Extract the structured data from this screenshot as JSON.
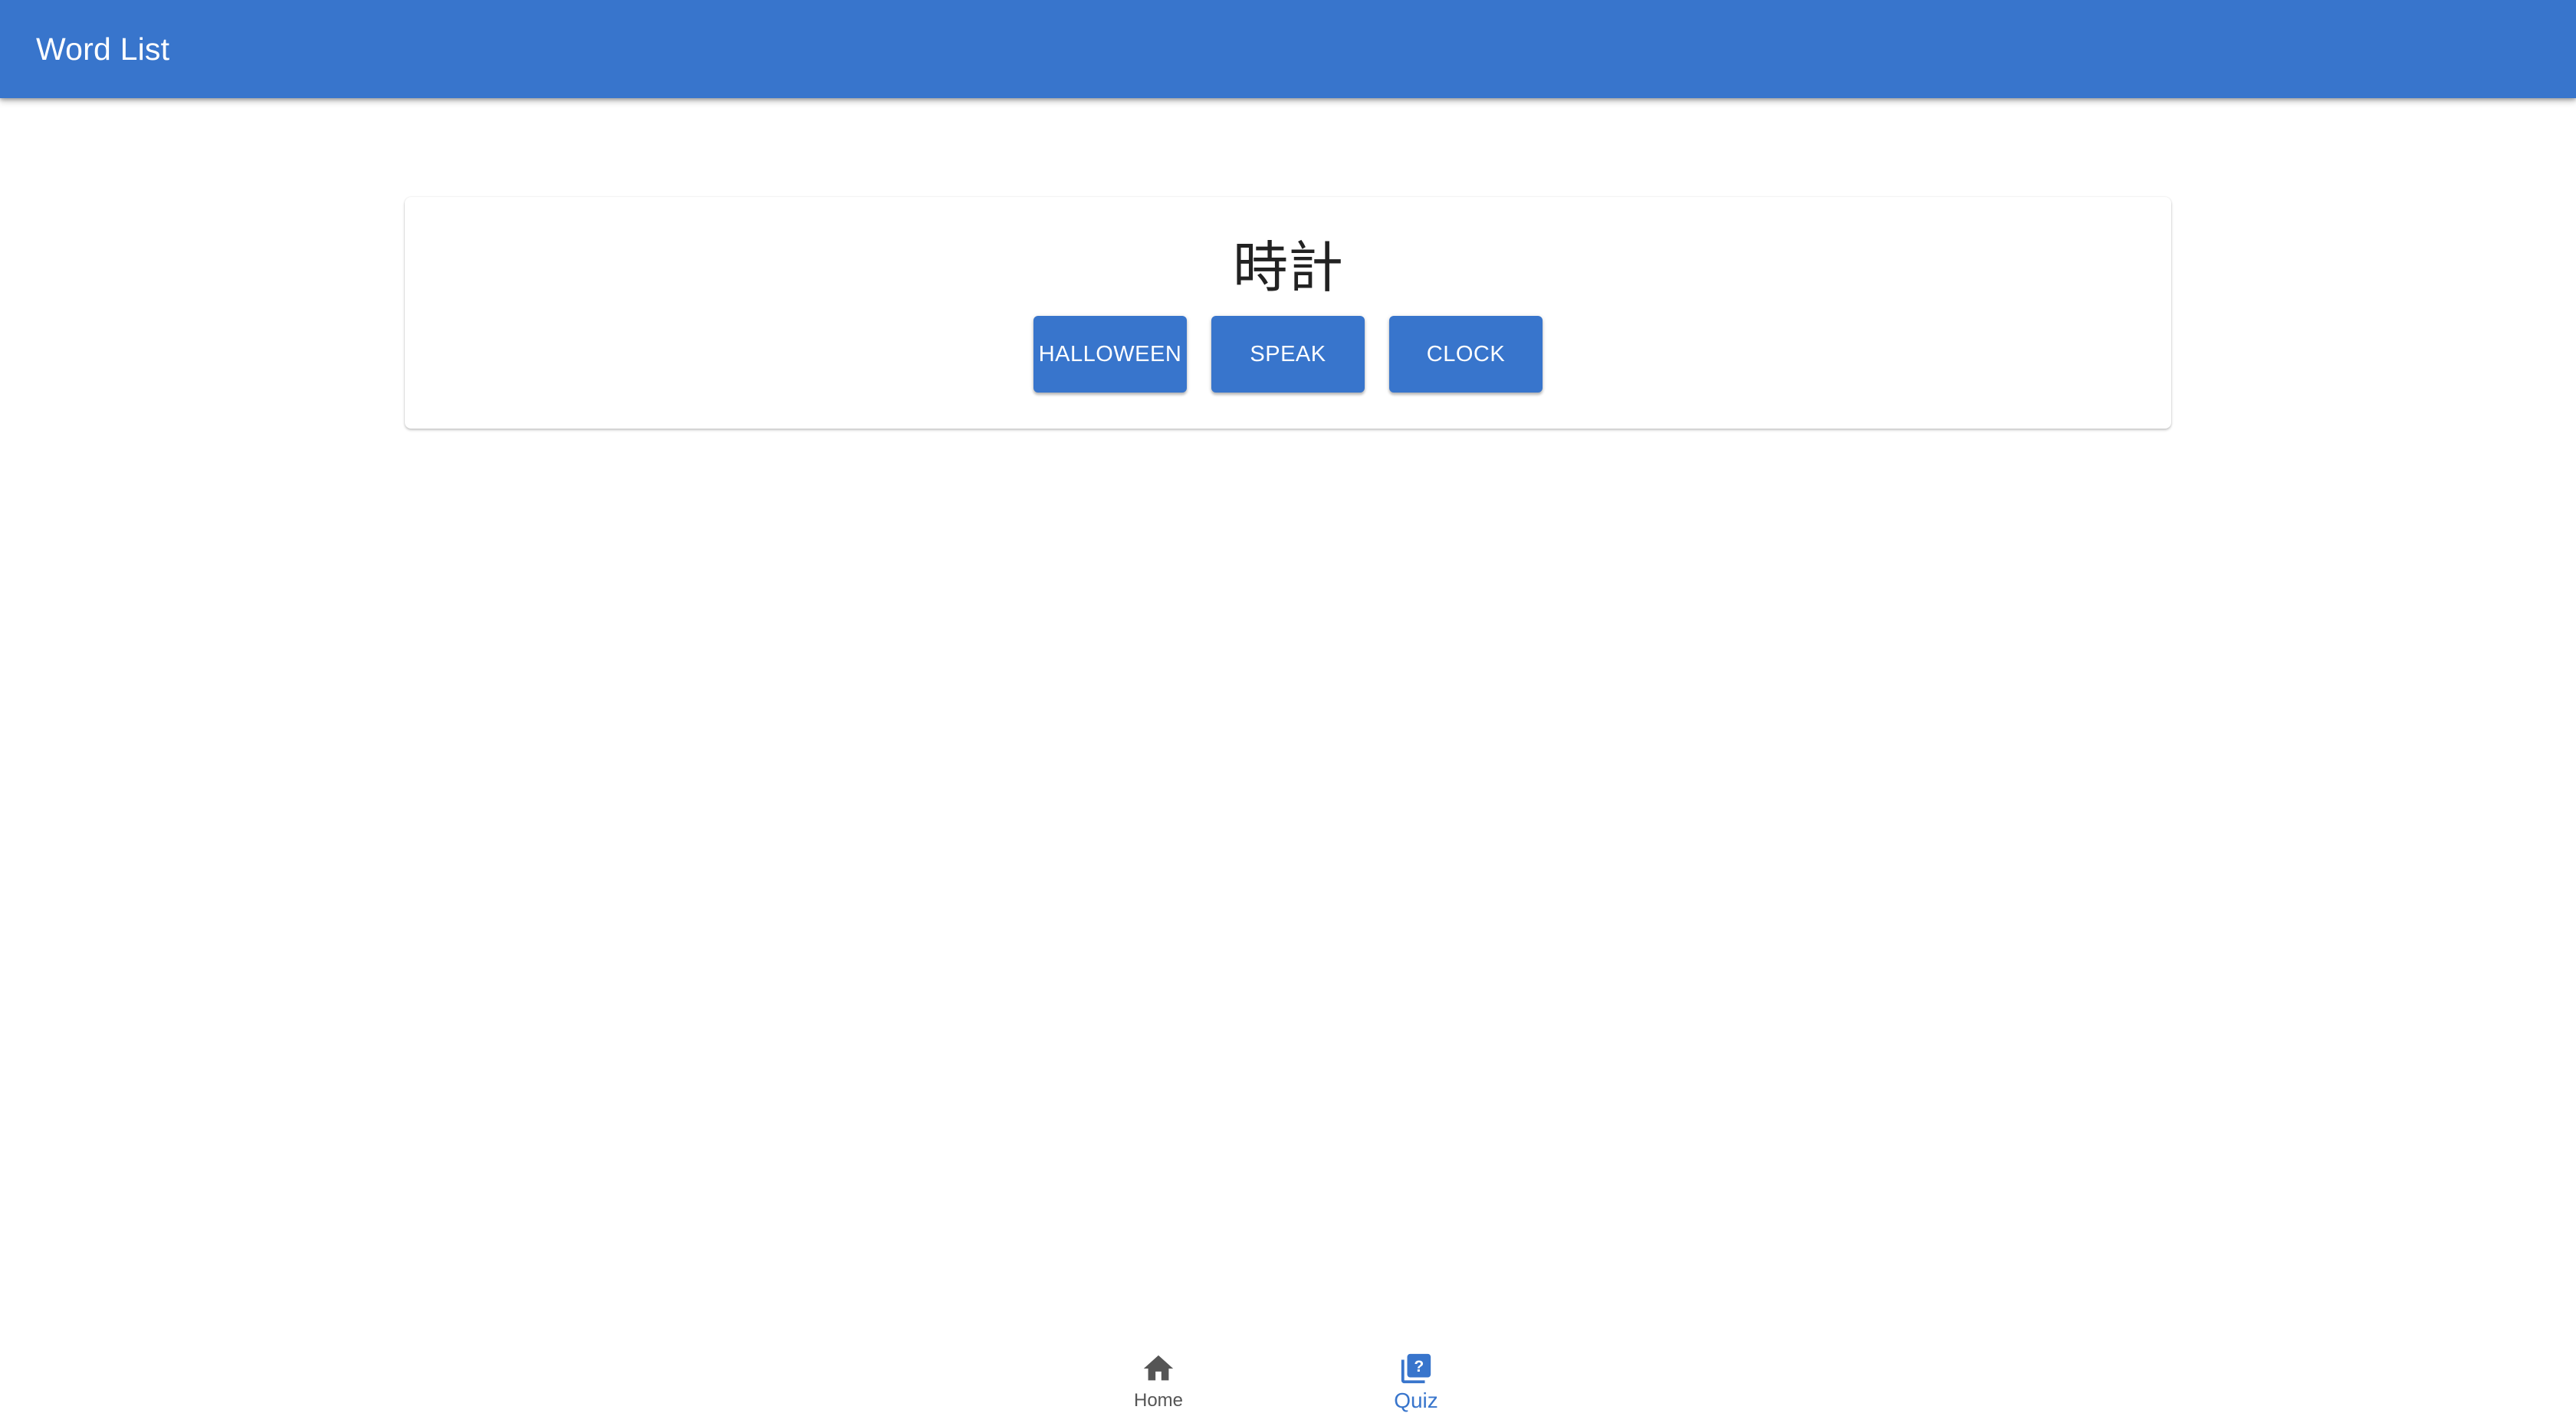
{
  "app_bar": {
    "title": "Word List"
  },
  "quiz": {
    "word": "時計",
    "choices": [
      "HALLOWEEN",
      "SPEAK",
      "CLOCK"
    ]
  },
  "bottom_nav": {
    "items": [
      {
        "label": "Home",
        "icon": "home-icon",
        "active": false
      },
      {
        "label": "Quiz",
        "icon": "quiz-icon",
        "active": true
      }
    ]
  },
  "colors": {
    "primary": "#3875cc",
    "inactive": "#555555",
    "background": "#ffffff"
  }
}
